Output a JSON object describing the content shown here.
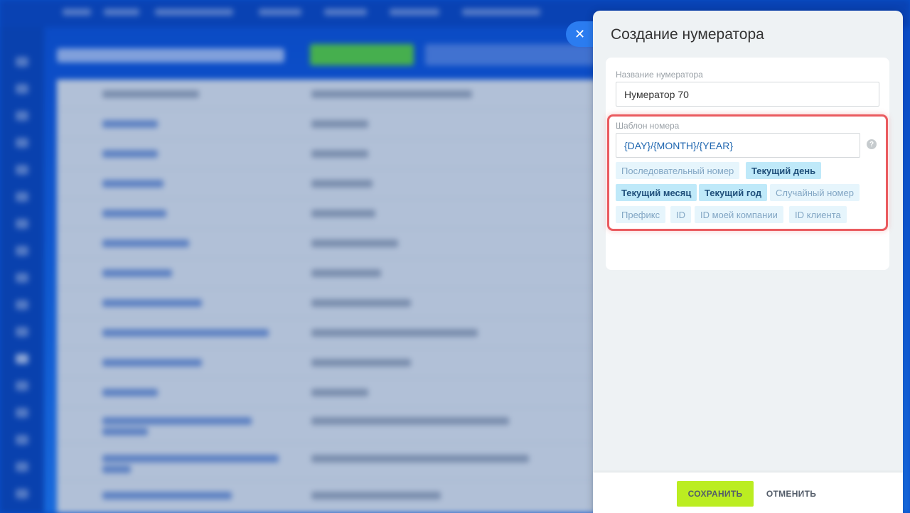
{
  "panel": {
    "title": "Создание нумератора",
    "close_icon": "close-icon"
  },
  "name_field": {
    "label": "Название нумератора",
    "value": "Нумератор 70"
  },
  "template_field": {
    "label": "Шаблон номера",
    "value": "{DAY}/{MONTH}/{YEAR}",
    "help_icon": "?"
  },
  "tags": [
    {
      "label": "Последовательный номер",
      "active": false
    },
    {
      "label": "Текущий день",
      "active": true
    },
    {
      "label": "Текущий месяц",
      "active": true
    },
    {
      "label": "Текущий год",
      "active": true
    },
    {
      "label": "Случайный номер",
      "active": false
    },
    {
      "label": "Префикс",
      "active": false
    },
    {
      "label": "ID",
      "active": false
    },
    {
      "label": "ID моей компании",
      "active": false
    },
    {
      "label": "ID клиента",
      "active": false
    }
  ],
  "footer": {
    "save_label": "СОХРАНИТЬ",
    "cancel_label": "ОТМЕНИТЬ"
  },
  "colors": {
    "highlight": "#ea5b5f",
    "save_button": "#bbed21",
    "tag_active": "#bfe9f9",
    "tag_inactive": "#e6f5fc"
  }
}
